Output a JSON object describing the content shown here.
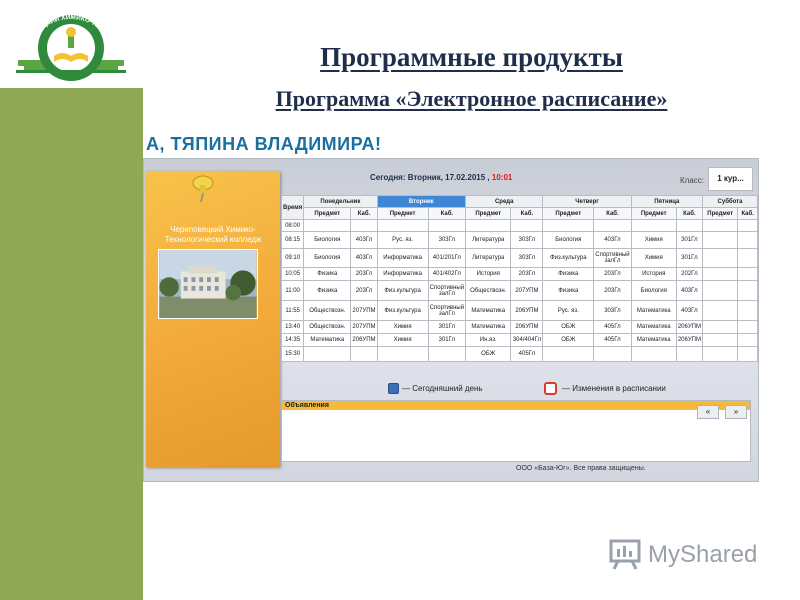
{
  "logo": {
    "arc_text": "ЧЕРЕПОВЕЦКИЙ ХИМИКО-ТЕХНОЛОГИЧЕСКИЙ КОЛЛЕДЖ"
  },
  "slide": {
    "title": "Программные  продукты",
    "subtitle": "Программа «Электронное расписание»"
  },
  "app": {
    "greeting": "А, ТЯПИНА ВЛАДИМИРА!",
    "banner": {
      "college_name_line1": "Череповецкий Химико-",
      "college_name_line2": "Технологический колледж"
    },
    "date_prefix": "Сегодня: Вторник, 17.02.2015 ,",
    "time": "10:01",
    "class_label": "Класс:",
    "class_value": "1 кур...",
    "table": {
      "time_header": "Время",
      "days": [
        "Понедельник",
        "Вторник",
        "Среда",
        "Четверг",
        "Пятница",
        "Суббота"
      ],
      "today_index": 1,
      "subject_header": "Предмет",
      "room_header": "Каб.",
      "rows": [
        {
          "time": "08:00",
          "cells": [
            [
              "",
              ""
            ],
            [
              "",
              ""
            ],
            [
              "",
              ""
            ],
            [
              "",
              ""
            ],
            [
              "",
              ""
            ],
            [
              "",
              ""
            ]
          ]
        },
        {
          "time": "08:15",
          "cells": [
            [
              "Биология",
              "403Гл"
            ],
            [
              "Рус. яз.",
              "303Гл"
            ],
            [
              "Литература",
              "303Гл"
            ],
            [
              "Биология",
              "403Гл"
            ],
            [
              "Химия",
              "301Гл"
            ],
            [
              "",
              ""
            ]
          ]
        },
        {
          "time": "09:10",
          "cells": [
            [
              "Биология",
              "403Гл"
            ],
            [
              "Информатика",
              "401/201Гл"
            ],
            [
              "Литература",
              "303Гл"
            ],
            [
              "Физ.культура",
              "Спортивный залГл"
            ],
            [
              "Химия",
              "301Гл"
            ],
            [
              "",
              ""
            ]
          ]
        },
        {
          "time": "10:05",
          "cells": [
            [
              "Физика",
              "203Гл"
            ],
            [
              "Информатика",
              "401/402Гл"
            ],
            [
              "История",
              "203Гл"
            ],
            [
              "Физика",
              "203Гл"
            ],
            [
              "История",
              "202Гл"
            ],
            [
              "",
              ""
            ]
          ]
        },
        {
          "time": "11:00",
          "cells": [
            [
              "Физика",
              "203Гл"
            ],
            [
              "Физ.культура",
              "Спортивный залГл"
            ],
            [
              "Обществозн.",
              "207УПМ"
            ],
            [
              "Физика",
              "203Гл"
            ],
            [
              "Биология",
              "403Гл"
            ],
            [
              "",
              ""
            ]
          ]
        },
        {
          "time": "11:55",
          "cells": [
            [
              "Обществозн.",
              "207УПМ"
            ],
            [
              "Физ.культура",
              "Спортивный залГл"
            ],
            [
              "Математика",
              "206УПМ"
            ],
            [
              "Рус. яз.",
              "303Гл"
            ],
            [
              "Математика",
              "403Гл"
            ],
            [
              "",
              ""
            ]
          ]
        },
        {
          "time": "13:40",
          "cells": [
            [
              "Обществозн.",
              "207УПМ"
            ],
            [
              "Химия",
              "301Гл"
            ],
            [
              "Математика",
              "206УПМ"
            ],
            [
              "ОБЖ",
              "405Гл"
            ],
            [
              "Математика",
              "206УПМ"
            ],
            [
              "",
              ""
            ]
          ]
        },
        {
          "time": "14:35",
          "cells": [
            [
              "Математика",
              "206УПМ"
            ],
            [
              "Химия",
              "301Гл"
            ],
            [
              "Ин.яз.",
              "304/404Гл"
            ],
            [
              "ОБЖ",
              "405Гл"
            ],
            [
              "Математика",
              "206УПМ"
            ],
            [
              "",
              ""
            ]
          ]
        },
        {
          "time": "15:30",
          "cells": [
            [
              "",
              ""
            ],
            [
              "",
              ""
            ],
            [
              "ОБЖ",
              "405Гл"
            ],
            [
              "",
              ""
            ],
            [
              "",
              ""
            ],
            [
              "",
              ""
            ]
          ]
        }
      ]
    },
    "legend": {
      "today_label": "— Сегодняшний день",
      "changes_label": "— Изменения в расписании"
    },
    "announcements": {
      "header": "Объявления",
      "prev_label": "«",
      "next_label": "»"
    },
    "copyright": "ООО «База-Юг». Все права защищены."
  },
  "watermark": {
    "text": "MyShared"
  },
  "colors": {
    "sidebar": "#8fa856",
    "title": "#1f2e4a",
    "greeting": "#1a6fa0",
    "today_column": "#3d87d6",
    "time_accent": "#d6201c",
    "announce_header": "#f5b93c",
    "banner": "#f2a93a"
  }
}
